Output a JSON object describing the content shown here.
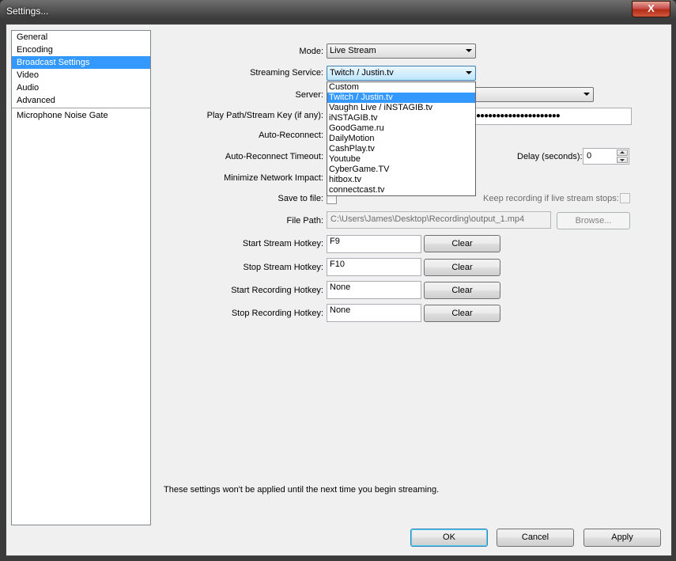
{
  "window": {
    "title": "Settings...",
    "close_label": "X"
  },
  "categories": [
    {
      "label": "General"
    },
    {
      "label": "Encoding"
    },
    {
      "label": "Broadcast Settings"
    },
    {
      "label": "Video"
    },
    {
      "label": "Audio"
    },
    {
      "label": "Advanced"
    },
    {
      "label": "Microphone Noise Gate"
    }
  ],
  "form": {
    "mode": {
      "label": "Mode:",
      "value": "Live Stream"
    },
    "service": {
      "label": "Streaming Service:",
      "value": "Twitch / Justin.tv"
    },
    "server": {
      "label": "Server:"
    },
    "playpath": {
      "label": "Play Path/Stream Key (if any):",
      "masked_value": "●●●●●●●●●●●●●●●●●●●●●"
    },
    "auto_reconnect": {
      "label": "Auto-Reconnect:"
    },
    "auto_reconnect_timeout": {
      "label": "Auto-Reconnect Timeout:"
    },
    "delay": {
      "label": "Delay (seconds):",
      "value": "0"
    },
    "minimize_network": {
      "label": "Minimize Network Impact:"
    },
    "save_to_file": {
      "label": "Save to file:"
    },
    "keep_recording": {
      "label": "Keep recording if live stream stops:"
    },
    "file_path": {
      "label": "File Path:",
      "value": "C:\\Users\\James\\Desktop\\Recording\\output_1.mp4",
      "browse_label": "Browse..."
    },
    "hotkeys": [
      {
        "label": "Start Stream Hotkey:",
        "value": "F9",
        "clear_label": "Clear"
      },
      {
        "label": "Stop Stream Hotkey:",
        "value": "F10",
        "clear_label": "Clear"
      },
      {
        "label": "Start Recording Hotkey:",
        "value": "None",
        "clear_label": "Clear"
      },
      {
        "label": "Stop Recording Hotkey:",
        "value": "None",
        "clear_label": "Clear"
      }
    ]
  },
  "dropdown_options": [
    "Custom",
    "Twitch / Justin.tv",
    "Vaughn Live / iNSTAGIB.tv",
    "iNSTAGIB.tv",
    "GoodGame.ru",
    "DailyMotion",
    "CashPlay.tv",
    "Youtube",
    "CyberGame.TV",
    "hitbox.tv",
    "connectcast.tv"
  ],
  "dropdown_selected": "Twitch / Justin.tv",
  "note": "These settings won't be applied until the next time you begin streaming.",
  "buttons": {
    "ok": "OK",
    "cancel": "Cancel",
    "apply": "Apply"
  }
}
